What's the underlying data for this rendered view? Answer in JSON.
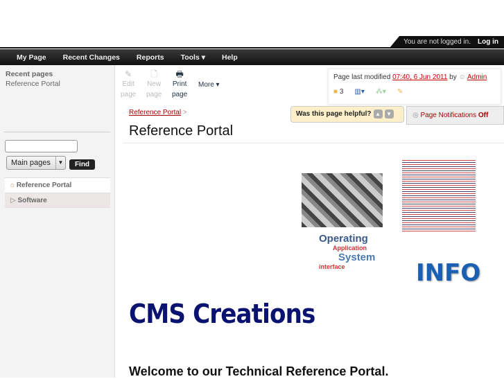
{
  "login": {
    "status": "You are not logged in.",
    "link": "Log in"
  },
  "nav": [
    "My Page",
    "Recent Changes",
    "Reports",
    "Tools ▾",
    "Help"
  ],
  "sidebar": {
    "recent_heading": "Recent pages",
    "recent_items": [
      "Reference Portal"
    ],
    "search_placeholder": "",
    "scope": "Main pages",
    "find": "Find",
    "tree": [
      "Reference Portal",
      "Software"
    ]
  },
  "toolbar": {
    "edit": [
      "Edit",
      "page"
    ],
    "new": [
      "New",
      "page"
    ],
    "print": [
      "Print",
      "page"
    ],
    "more": "More ▾"
  },
  "modified": {
    "label": "Page last modified",
    "date": "07:40, 6 Jun 2011",
    "by": "by",
    "user": "Admin",
    "files": "3"
  },
  "breadcrumb": "Reference Portal",
  "title": "Reference Portal",
  "helpful": "Was this page helpful?",
  "notifications": {
    "label": "Page Notifications",
    "state": "Off"
  },
  "images": {
    "os": [
      "Operating",
      "System",
      "interface",
      "Application"
    ],
    "info": "INFO"
  },
  "logo": "CMS Creations",
  "welcome": "Welcome to our Technical Reference Portal."
}
